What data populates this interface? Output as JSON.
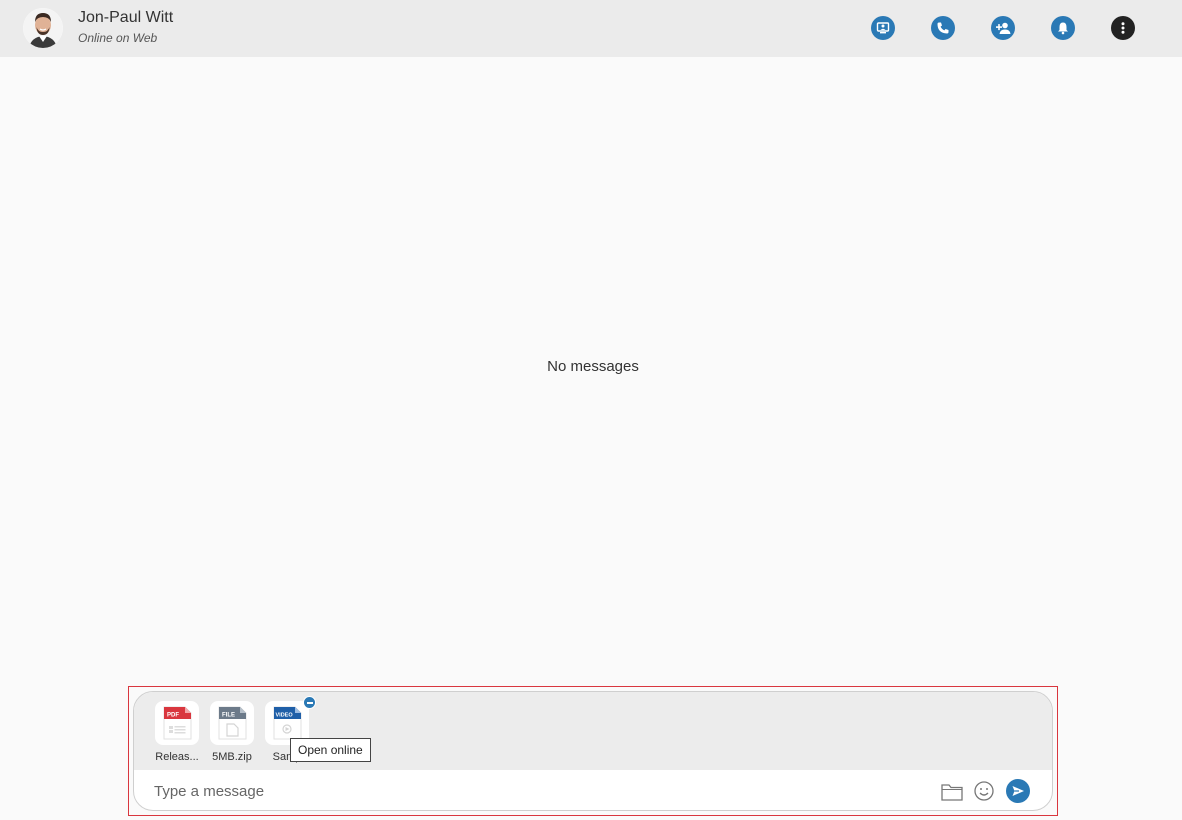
{
  "contact": {
    "name": "Jon-Paul Witt",
    "status": "Online on Web"
  },
  "header_actions": [
    {
      "icon": "screen-share-icon"
    },
    {
      "icon": "phone-icon"
    },
    {
      "icon": "add-person-icon"
    },
    {
      "icon": "bell-icon"
    },
    {
      "icon": "more-vertical-icon"
    }
  ],
  "conversation": {
    "empty_text": "No messages"
  },
  "attachments": [
    {
      "name": "Releas...",
      "type_label": "PDF",
      "color": "#d9363e"
    },
    {
      "name": "5MB.zip",
      "type_label": "FILE",
      "color": "#6c7a89"
    },
    {
      "name": "Samp",
      "type_label": "VIDEO",
      "color": "#1f5fa8"
    }
  ],
  "tooltip": {
    "text": "Open online"
  },
  "composer": {
    "placeholder": "Type a message"
  },
  "colors": {
    "accent": "#2a79b5",
    "focus_border": "#d9363e"
  }
}
